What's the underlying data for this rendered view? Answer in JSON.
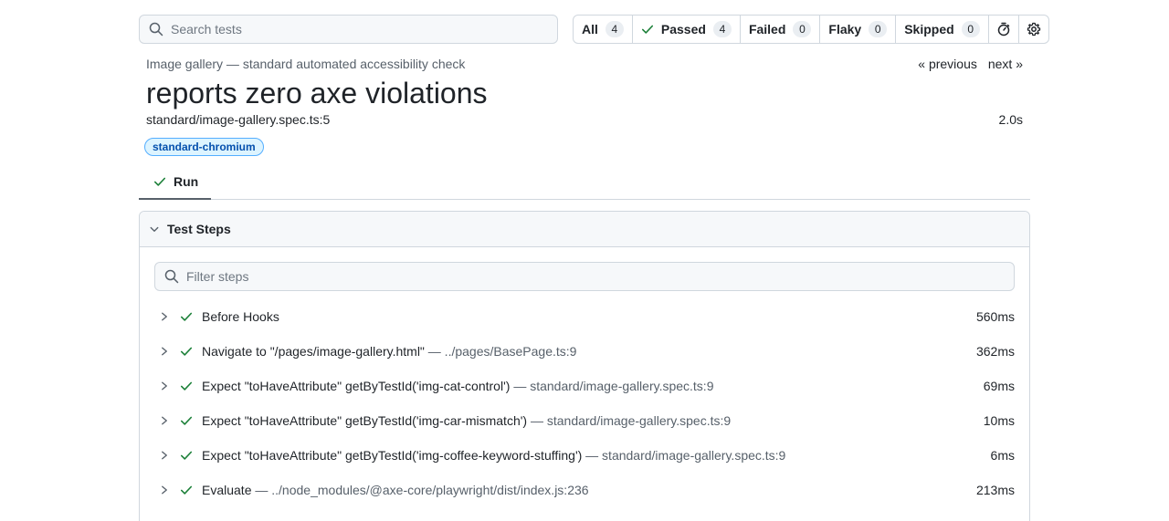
{
  "search": {
    "placeholder": "Search tests"
  },
  "filters": [
    {
      "label": "All",
      "count": "4"
    },
    {
      "label": "Passed",
      "count": "4"
    },
    {
      "label": "Failed",
      "count": "0"
    },
    {
      "label": "Flaky",
      "count": "0"
    },
    {
      "label": "Skipped",
      "count": "0"
    }
  ],
  "header": {
    "suite": "Image gallery — standard automated accessibility check",
    "title": "reports zero axe violations",
    "location": "standard/image-gallery.spec.ts:5",
    "duration": "2.0s",
    "project": "standard-chromium",
    "previous": "« previous",
    "next": "next »"
  },
  "tabs": [
    {
      "label": "Run"
    }
  ],
  "steps_panel": {
    "title": "Test Steps",
    "filter_placeholder": "Filter steps",
    "steps": [
      {
        "title": "Before Hooks",
        "location": "",
        "duration": "560ms"
      },
      {
        "title": "Navigate to \"/pages/image-gallery.html\"",
        "location": "— ../pages/BasePage.ts:9",
        "duration": "362ms"
      },
      {
        "title": "Expect \"toHaveAttribute\" getByTestId('img-cat-control')",
        "location": "— standard/image-gallery.spec.ts:9",
        "duration": "69ms"
      },
      {
        "title": "Expect \"toHaveAttribute\" getByTestId('img-car-mismatch')",
        "location": "— standard/image-gallery.spec.ts:9",
        "duration": "10ms"
      },
      {
        "title": "Expect \"toHaveAttribute\" getByTestId('img-coffee-keyword-stuffing')",
        "location": "— standard/image-gallery.spec.ts:9",
        "duration": "6ms"
      },
      {
        "title": "Evaluate",
        "location": "— ../node_modules/@axe-core/playwright/dist/index.js:236",
        "duration": "213ms"
      }
    ]
  }
}
